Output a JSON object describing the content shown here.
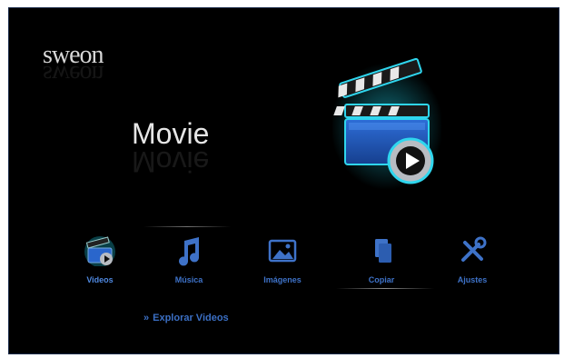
{
  "brand": {
    "logo_text": "sweon"
  },
  "main": {
    "title": "Movie"
  },
  "menu": {
    "items": [
      {
        "label": "Videos",
        "icon": "clapperboard-icon"
      },
      {
        "label": "Música",
        "icon": "music-note-icon"
      },
      {
        "label": "Imágenes",
        "icon": "picture-icon"
      },
      {
        "label": "Copiar",
        "icon": "copy-icon"
      },
      {
        "label": "Ajustes",
        "icon": "tools-icon"
      }
    ],
    "selected": "Videos"
  },
  "explore": {
    "arrow": "»",
    "label": "Explorar Videos"
  },
  "colors": {
    "accent": "#3e72c8",
    "background": "#000000",
    "glow": "#1fd1e8"
  }
}
